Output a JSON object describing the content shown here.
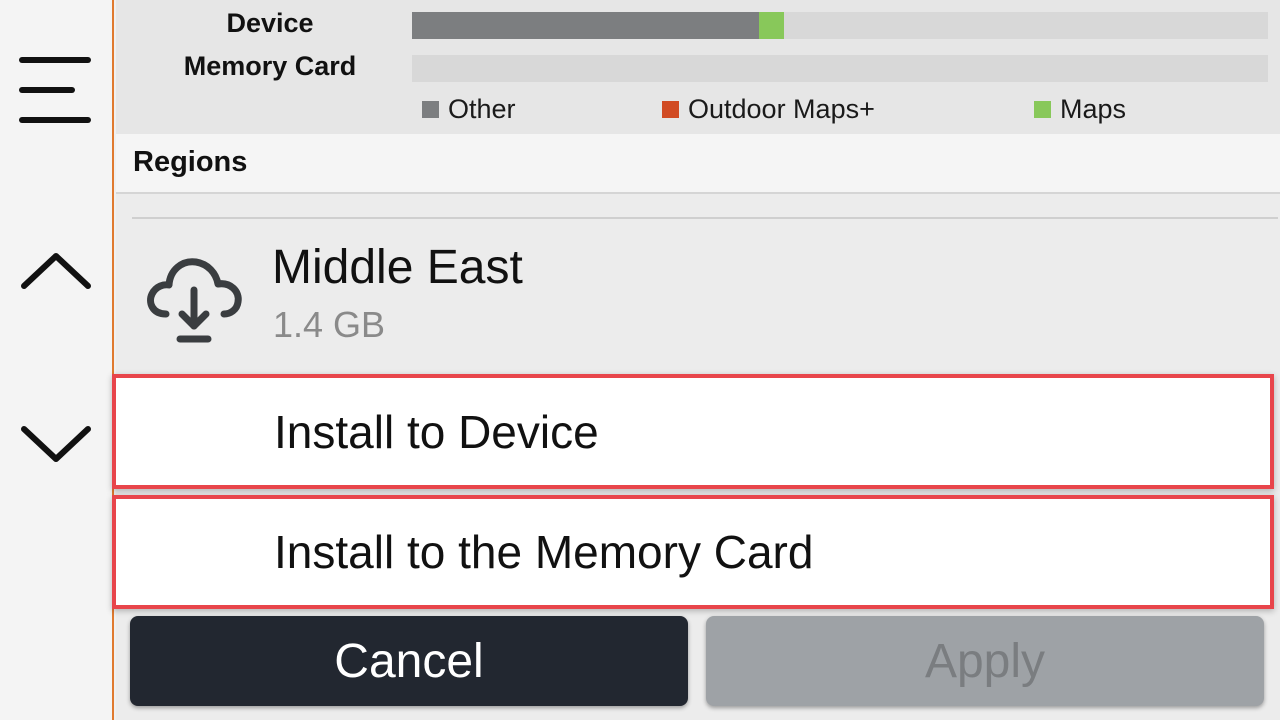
{
  "storage": {
    "device_label": "Device",
    "card_label": "Memory Card",
    "device_usage": {
      "other": 0.405,
      "outdoor_maps_plus": 0.0,
      "maps": 0.03
    },
    "card_usage": {
      "other": 0.0,
      "outdoor_maps_plus": 0.0,
      "maps": 0.0
    },
    "legend": [
      {
        "label": "Other",
        "color": "#7c7e80"
      },
      {
        "label": "Outdoor Maps+",
        "color": "#d14b23"
      },
      {
        "label": "Maps",
        "color": "#88c85a"
      }
    ]
  },
  "regions_header": "Regions",
  "region": {
    "name": "Middle East",
    "size": "1.4 GB",
    "icon": "cloud-download-icon"
  },
  "options": {
    "install_device": "Install to Device",
    "install_card": "Install to the Memory Card"
  },
  "buttons": {
    "cancel": "Cancel",
    "apply": "Apply"
  },
  "rail": {
    "icons": [
      "menu-icon",
      "chevron-up-icon",
      "chevron-down-icon"
    ]
  }
}
